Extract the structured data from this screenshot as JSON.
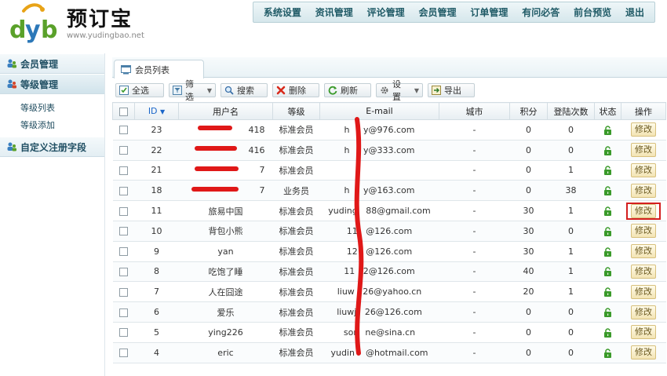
{
  "app": {
    "title": "预订宝",
    "url_text": "www.yudingbao.net",
    "logo_letters": "dyb"
  },
  "topnav": [
    "系统设置",
    "资讯管理",
    "评论管理",
    "会员管理",
    "订单管理",
    "有问必答",
    "前台预览",
    "退出"
  ],
  "sidebar": {
    "sections": [
      {
        "label": "会员管理"
      },
      {
        "label": "等级管理",
        "items": [
          "等级列表",
          "等级添加"
        ]
      },
      {
        "label": "自定义注册字段"
      }
    ]
  },
  "tab": {
    "label": "会员列表"
  },
  "toolbar": {
    "select_all": "全选",
    "filter": "筛选",
    "search": "搜索",
    "delete": "删除",
    "refresh": "刷新",
    "settings": "设置",
    "export": "导出"
  },
  "table": {
    "columns": [
      "",
      "ID",
      "用户名",
      "等级",
      "E-mail",
      "城市",
      "积分",
      "登陆次数",
      "状态",
      "操作"
    ],
    "edit_label": "修改",
    "rows": [
      {
        "id": "23",
        "user": "418",
        "level": "标准会员",
        "email": "h     y@976.com",
        "city": "-",
        "points": "0",
        "logins": "0"
      },
      {
        "id": "22",
        "user": "416",
        "level": "标准会员",
        "email": "h     y@333.com",
        "city": "-",
        "points": "0",
        "logins": "0"
      },
      {
        "id": "21",
        "user": "7",
        "level": "标准会员",
        "email": "",
        "city": "-",
        "points": "0",
        "logins": "1"
      },
      {
        "id": "18",
        "user": "7",
        "level": "业务员",
        "email": "h     y@163.com",
        "city": "-",
        "points": "0",
        "logins": "38"
      },
      {
        "id": "11",
        "user": "旅易中国",
        "level": "标准会员",
        "email": "yuding   88@gmail.com",
        "city": "-",
        "points": "30",
        "logins": "1"
      },
      {
        "id": "10",
        "user": "背包小熊",
        "level": "标准会员",
        "email": "11   @126.com",
        "city": "-",
        "points": "30",
        "logins": "0"
      },
      {
        "id": "9",
        "user": "yan",
        "level": "标准会员",
        "email": "12   @126.com",
        "city": "-",
        "points": "30",
        "logins": "1"
      },
      {
        "id": "8",
        "user": "吃饱了睡",
        "level": "标准会员",
        "email": "11   2@126.com",
        "city": "-",
        "points": "40",
        "logins": "1"
      },
      {
        "id": "7",
        "user": "人在囧途",
        "level": "标准会员",
        "email": "liuw   26@yahoo.cn",
        "city": "-",
        "points": "20",
        "logins": "1"
      },
      {
        "id": "6",
        "user": "爱乐",
        "level": "标准会员",
        "email": "liuwj   26@126.com",
        "city": "-",
        "points": "0",
        "logins": "0"
      },
      {
        "id": "5",
        "user": "ying226",
        "level": "标准会员",
        "email": "sor   ne@sina.cn",
        "city": "-",
        "points": "0",
        "logins": "0"
      },
      {
        "id": "4",
        "user": "eric",
        "level": "标准会员",
        "email": "yudin    @hotmail.com",
        "city": "-",
        "points": "0",
        "logins": "0"
      }
    ]
  },
  "colors": {
    "accent": "#1f5a66",
    "annotation_red": "#e01818",
    "lock_green": "#3a9a2a"
  }
}
